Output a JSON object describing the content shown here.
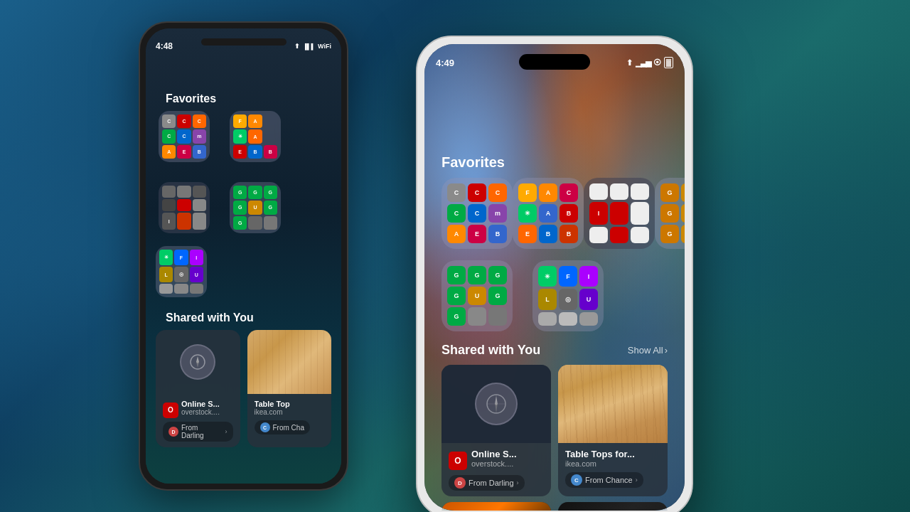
{
  "background": {
    "gradient": "linear-gradient(135deg, #1a5f8a, #0d3d5e, #1a6b6b)"
  },
  "phone_bg": {
    "time": "4:48",
    "location_icon": "▲",
    "screen_title": "Favorites",
    "shared_title": "Shared with You",
    "folders": [
      {
        "colors": [
          "#8a8a8a",
          "#cc0000",
          "#ff6600",
          "#00aa44",
          "#0066cc",
          "#ffaa00",
          "#aa00aa",
          "#00aacc",
          "#ffcc00"
        ],
        "letters": [
          "C",
          "C",
          "C",
          "C",
          "C",
          "m",
          "A",
          "E",
          "B"
        ]
      },
      {
        "colors": [
          "#ffaa00",
          "#ffcc00",
          "#ff6600",
          "#aa4400",
          "#cc0000",
          "#00aa44",
          "#0066cc",
          "#ffaa00",
          "#00aacc"
        ],
        "letters": [
          "F",
          "A",
          "✳",
          "E",
          "B",
          "B",
          "",
          "",
          ""
        ]
      },
      {
        "colors": [
          "#555",
          "#666",
          "#777",
          "#888",
          "#444",
          "#333",
          "#999",
          "#aaa",
          "#bbb"
        ],
        "letters": [
          "",
          "",
          "",
          "",
          "",
          "",
          "",
          "",
          ""
        ]
      },
      {
        "colors": [
          "#00aa44",
          "#00aa44",
          "#00aa44",
          "#00aa44",
          "#cc8800",
          "#00aa44",
          "#00aa44",
          "#00aa44",
          "#00aa44"
        ],
        "letters": [
          "G",
          "G",
          "G",
          "G",
          "U",
          "G",
          "G",
          "G",
          "G"
        ]
      },
      {
        "colors": [
          "#00cc66",
          "#0066ff",
          "#aa00ff",
          "#aa8800",
          "#666",
          "#6600cc",
          "#ccaa00",
          "#888",
          "#999"
        ],
        "letters": [
          "✳",
          "F",
          "I",
          "L",
          "◎",
          "U",
          "",
          "",
          ""
        ]
      }
    ],
    "shared_cards": [
      {
        "type": "compass",
        "title": "Online S...",
        "url": "overstock....",
        "from": "From Darling",
        "from_color": "#cc4444"
      },
      {
        "type": "wood",
        "title": "Table Top",
        "url": "ikea.com",
        "from": "From Cha",
        "from_color": "#4488cc"
      }
    ]
  },
  "phone_fg": {
    "time": "4:49",
    "location_icon": "▲",
    "signal": "●●●",
    "wifi": "wifi",
    "battery": "battery",
    "screen_title": "Favorites",
    "shared_title": "Shared with You",
    "show_all": "Show All",
    "folders": [
      {
        "colors": [
          "#8a8a8a",
          "#cc0000",
          "#ff6600",
          "#00aa44",
          "#0066cc",
          "#ffaa00",
          "#aa00aa",
          "#00aacc",
          "#ffcc00"
        ],
        "letters": [
          "C",
          "C",
          "C",
          "C",
          "C",
          "m",
          "A",
          "E",
          "B"
        ]
      },
      {
        "colors": [
          "#ffaa00",
          "#ffcc00",
          "#ff6600",
          "#aa4400",
          "#cc0000",
          "#00aa44",
          "#0066cc",
          "#ffaa00",
          "#00aacc"
        ],
        "letters": [
          "F",
          "A",
          "✳",
          "E",
          "B",
          "B",
          "",
          "",
          ""
        ]
      },
      {
        "colors": [
          "#555",
          "#666",
          "#777",
          "#333",
          "#444",
          "#cc0000",
          "#888",
          "#aaa",
          "#bbb"
        ],
        "letters": [
          "",
          "",
          "",
          "I",
          "",
          "",
          "",
          "",
          ""
        ]
      },
      {
        "colors": [
          "#00aa44",
          "#00aa44",
          "#00aa44",
          "#00aa44",
          "#cc8800",
          "#00aa44",
          "#00aa44",
          "#00aa44",
          "#00aa44"
        ],
        "letters": [
          "G",
          "G",
          "G",
          "G",
          "U",
          "G",
          "G",
          "G",
          "G"
        ]
      },
      {
        "colors": [
          "#00cc66",
          "#0066ff",
          "#aa00ff",
          "#aa8800",
          "#666",
          "#6600cc",
          "#ccaa00",
          "#888",
          "#999"
        ],
        "letters": [
          "✳",
          "F",
          "I",
          "L",
          "◎",
          "U",
          "",
          "",
          ""
        ]
      }
    ],
    "shared_cards": [
      {
        "type": "compass",
        "title": "Online S...",
        "url": "overstock....",
        "from": "From Darling",
        "from_color": "#cc4444"
      },
      {
        "type": "wood",
        "title": "Table Tops for...",
        "url": "ikea.com",
        "from": "From Chance",
        "from_color": "#4488cc"
      }
    ],
    "bottom_cards": [
      {
        "type": "orange_helmet",
        "color": "#cc6600"
      },
      {
        "type": "person_dark",
        "color": "#222"
      }
    ]
  },
  "icons": {
    "compass": "◉",
    "chevron": "›",
    "location": "⬆"
  }
}
